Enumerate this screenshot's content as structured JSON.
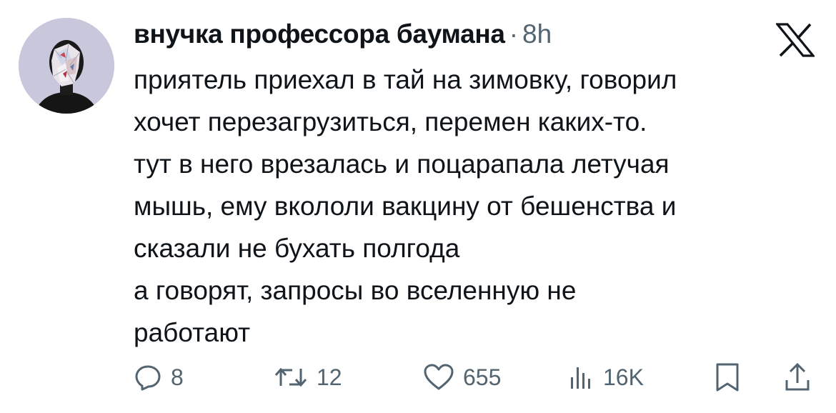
{
  "author": {
    "display_name": "внучка профессора баумана",
    "separator": "·",
    "timestamp": "8h"
  },
  "platform_logo": "x-logo-icon",
  "tweet_lines": [
    "приятель приехал в тай на зимовку, говорил",
    "хочет перезагрузиться, перемен каких-то.",
    "тут в него врезалась и поцарапала летучая",
    "мышь, ему вкололи вакцину от бешенства и",
    "сказали не бухать полгода",
    "а говорят, запросы во вселенную не",
    "работают"
  ],
  "actions": {
    "reply_count": "8",
    "retweet_count": "12",
    "like_count": "655",
    "views_count": "16K"
  },
  "colors": {
    "text": "#0f1419",
    "secondary": "#536471",
    "background": "#ffffff",
    "avatar_bg": "#c9c7dc"
  }
}
